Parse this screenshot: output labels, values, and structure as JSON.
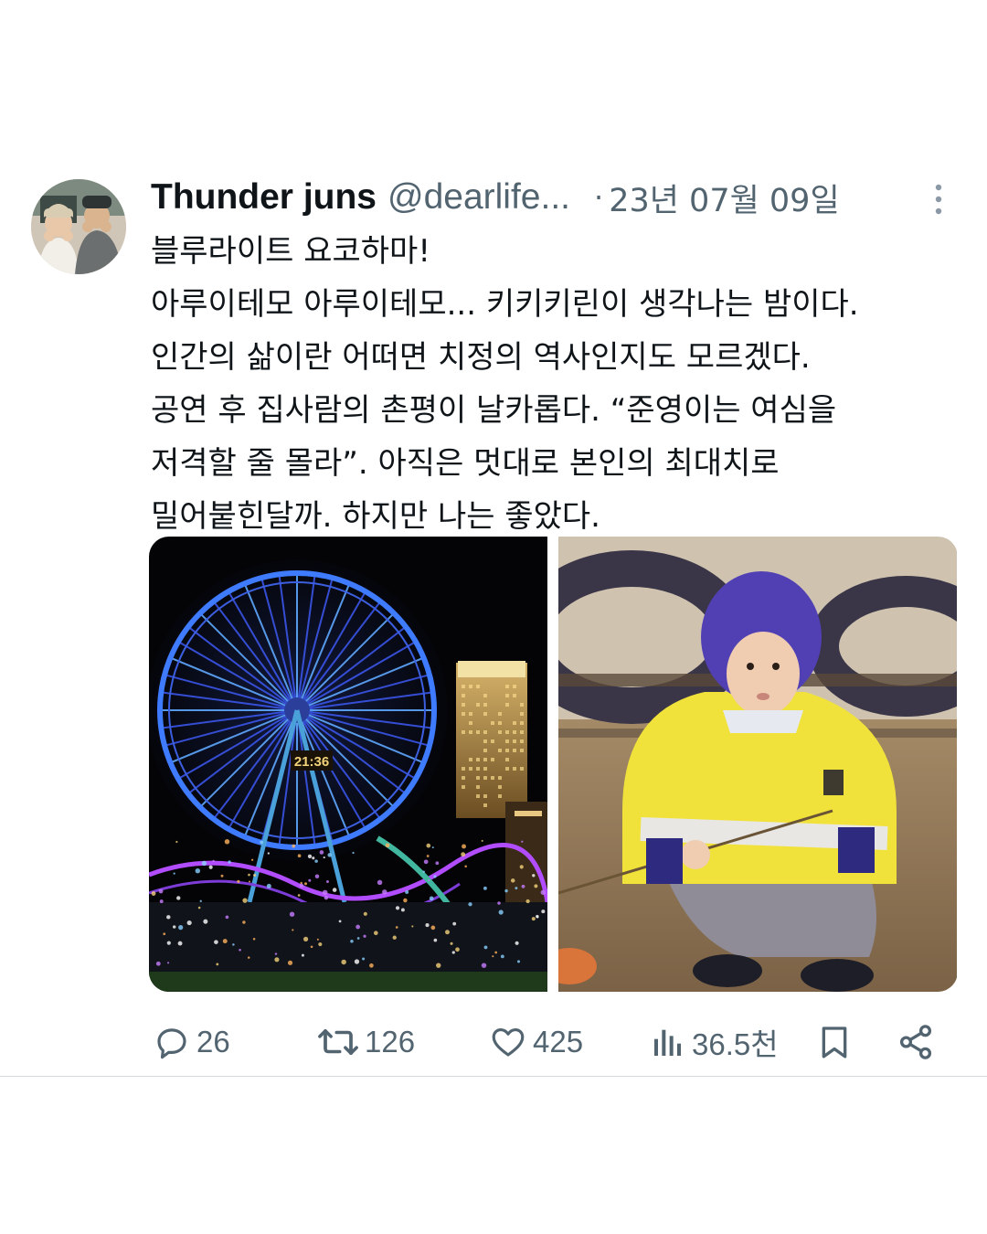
{
  "tweet": {
    "display_name": "Thunder juns",
    "handle": "@dearlife...",
    "separator": "·",
    "date": "23년 07월 09일",
    "text_lines": [
      "블루라이트 요코하마!",
      "아루이테모 아루이테모... 키키키린이 생각나는 밤이다.",
      "인간의 삶이란 어떠면 치정의 역사인지도 모르겠다.",
      "공연 후 집사람의 촌평이 날카롭다. “준영이는 여심을",
      "저격할 줄 몰라”. 아직은 멋대로 본인의 최대치로",
      "밀어붙힌달까. 하지만 나는 좋았다."
    ],
    "media": {
      "photo1_clock_text": "21:36"
    }
  },
  "actions": {
    "replies": "26",
    "retweets": "126",
    "likes": "425",
    "views": "36.5천"
  },
  "icons": {
    "avatar": "avatar",
    "more": "more-vertical-icon",
    "reply": "reply-icon",
    "retweet": "retweet-icon",
    "like": "heart-icon",
    "views": "views-chart-icon",
    "bookmark": "bookmark-icon",
    "share": "share-icon"
  },
  "colors": {
    "text": "#0f1419",
    "secondary": "#536471"
  }
}
